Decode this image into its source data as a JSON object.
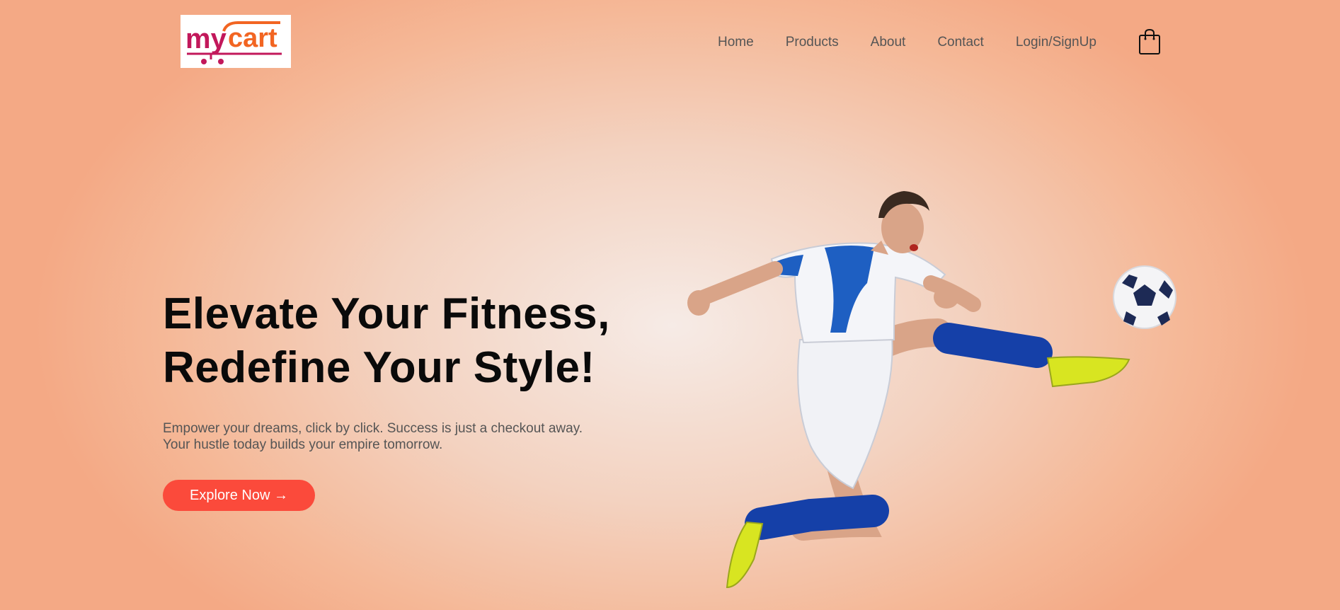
{
  "brand": {
    "logo_text_a": "my",
    "logo_text_b": "cart"
  },
  "nav": {
    "items": [
      {
        "label": "Home"
      },
      {
        "label": "Products"
      },
      {
        "label": "About"
      },
      {
        "label": "Contact"
      },
      {
        "label": "Login/SignUp"
      }
    ],
    "cart_icon": "shopping-bag-icon"
  },
  "hero": {
    "headline_line1": "Elevate Your Fitness,",
    "headline_line2": "Redefine Your Style!",
    "subtext_line1": "Empower your dreams, click by click. Success is just a checkout away.",
    "subtext_line2": "Your hustle today builds your empire tomorrow.",
    "cta_label": "Explore Now →"
  },
  "colors": {
    "accent": "#fb4a3b",
    "logo_magenta": "#c2185b",
    "logo_orange": "#f26522",
    "background": "#f4a985"
  }
}
